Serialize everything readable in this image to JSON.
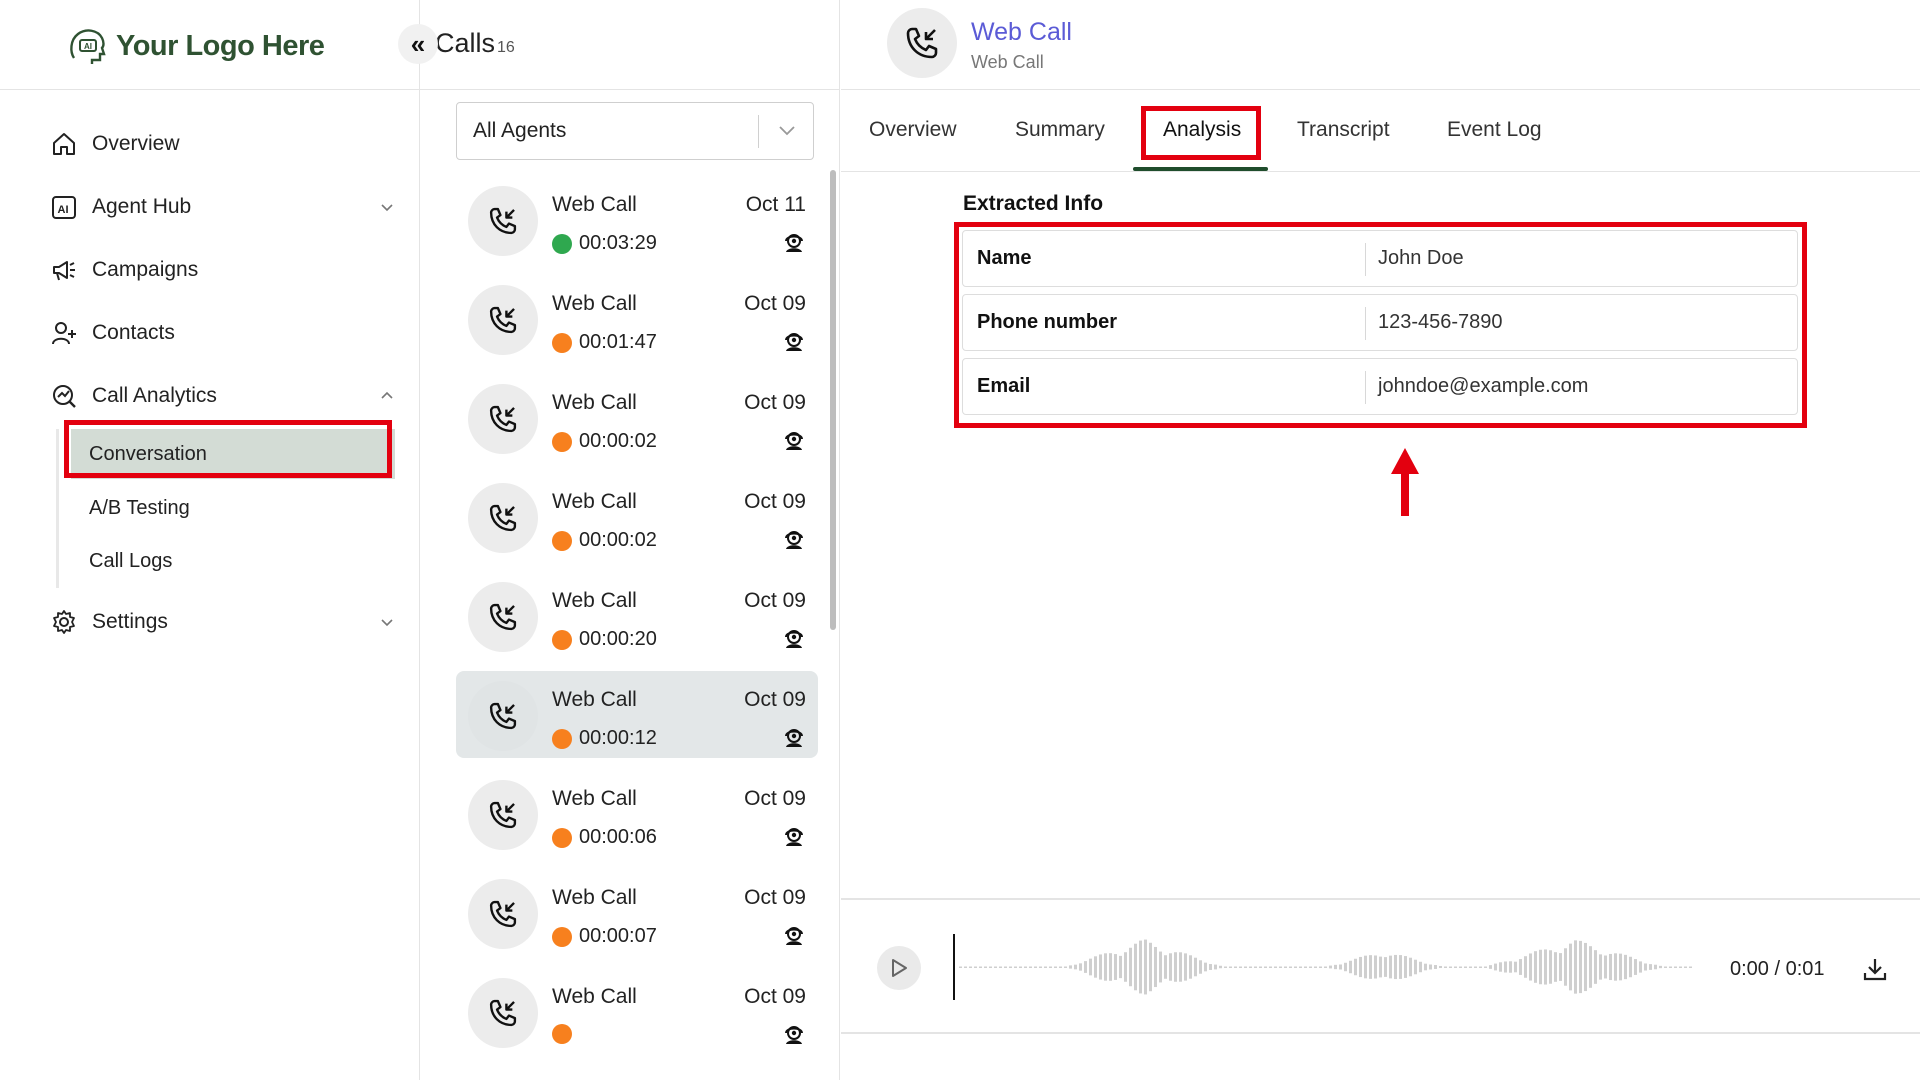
{
  "sidebar": {
    "logo_text": "Your Logo Here",
    "logo_badge": "AI",
    "items": [
      {
        "label": "Overview",
        "icon": "home-icon"
      },
      {
        "label": "Agent Hub",
        "icon": "ai-agent-icon"
      },
      {
        "label": "Campaigns",
        "icon": "megaphone-icon"
      },
      {
        "label": "Contacts",
        "icon": "add-user-icon"
      },
      {
        "label": "Call Analytics",
        "icon": "analytics-icon"
      },
      {
        "label": "Settings",
        "icon": "gear-icon"
      }
    ],
    "subitems": [
      {
        "label": "Conversation",
        "active": true
      },
      {
        "label": "A/B Testing",
        "active": false
      },
      {
        "label": "Call Logs",
        "active": false
      }
    ]
  },
  "calls": {
    "title": "Calls",
    "count": "16",
    "collapse_glyph": "«",
    "agent_filter": "All Agents",
    "items": [
      {
        "name": "Web Call",
        "date": "Oct 11",
        "duration": "00:03:29",
        "status_color": "#2fa84f"
      },
      {
        "name": "Web Call",
        "date": "Oct 09",
        "duration": "00:01:47",
        "status_color": "#f7801e"
      },
      {
        "name": "Web Call",
        "date": "Oct 09",
        "duration": "00:00:02",
        "status_color": "#f7801e"
      },
      {
        "name": "Web Call",
        "date": "Oct 09",
        "duration": "00:00:02",
        "status_color": "#f7801e"
      },
      {
        "name": "Web Call",
        "date": "Oct 09",
        "duration": "00:00:20",
        "status_color": "#f7801e"
      },
      {
        "name": "Web Call",
        "date": "Oct 09",
        "duration": "00:00:12",
        "status_color": "#f7801e",
        "selected": true
      },
      {
        "name": "Web Call",
        "date": "Oct 09",
        "duration": "00:00:06",
        "status_color": "#f7801e"
      },
      {
        "name": "Web Call",
        "date": "Oct 09",
        "duration": "00:00:07",
        "status_color": "#f7801e"
      },
      {
        "name": "Web Call",
        "date": "Oct 09",
        "duration": "",
        "status_color": "#f7801e"
      }
    ]
  },
  "detail": {
    "title": "Web Call",
    "subtitle": "Web Call",
    "tabs": [
      "Overview",
      "Summary",
      "Analysis",
      "Transcript",
      "Event Log"
    ],
    "active_tab": "Analysis",
    "extracted_title": "Extracted Info",
    "fields": [
      {
        "key": "Name",
        "value": "John Doe"
      },
      {
        "key": "Phone number",
        "value": "123-456-7890"
      },
      {
        "key": "Email",
        "value": "johndoe@example.com"
      }
    ],
    "player": {
      "time": "0:00 / 0:01"
    }
  },
  "colors": {
    "brand_green": "#2f5232",
    "link_purple": "#5b5bd6",
    "highlight_red": "#e3000f",
    "active_nav_bg": "#d3dcd5"
  }
}
